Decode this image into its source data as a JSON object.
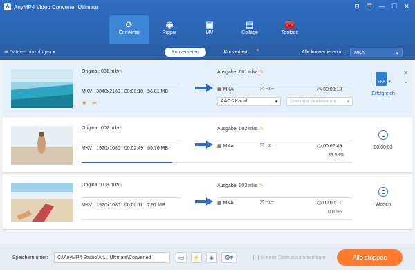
{
  "app": {
    "title": "AnyMP4 Video Converter Ultimate",
    "logo_letter": "A"
  },
  "window_buttons": [
    "⊡",
    "☰",
    "—",
    "☐",
    "✕"
  ],
  "nav": [
    {
      "label": "Converter",
      "icon": "⟳",
      "active": true
    },
    {
      "label": "Ripper",
      "icon": "◉"
    },
    {
      "label": "MV",
      "icon": "▣"
    },
    {
      "label": "Collage",
      "icon": "▤"
    },
    {
      "label": "Toolbox",
      "icon": "🧰"
    }
  ],
  "subbar": {
    "add_label": "Dateien hinzufügen",
    "seg_on": "Konvertieren",
    "seg_off": "Konvertiert",
    "convert_all_label": "Alle konvertieren in:",
    "convert_all_value": "MKA"
  },
  "rows": [
    {
      "orig": "Original: 001.mkv",
      "fmt": "MKV",
      "res": "3840x2160",
      "dur": "00:00:18",
      "size": "56.81 MB",
      "out": "Ausgabe: 001.mka",
      "ofmt": "MKA",
      "ores": "--x--",
      "odur": "00:00:18",
      "audio": "AAC-2Kanal",
      "subtitle": "Untertitel deaktivieren",
      "progress": null,
      "pct": "",
      "status": "Erfolgreich",
      "status_icon": "MKA"
    },
    {
      "orig": "Original: 002.mkv",
      "fmt": "MKV",
      "res": "1920x1080",
      "dur": "00:02:49",
      "size": "69.70 MB",
      "out": "Ausgabe: 002.mka",
      "ofmt": "MKA",
      "ores": "--x--",
      "odur": "00:02:49",
      "progress": 0.3333,
      "pct": "33.33%",
      "status": "00:00:03"
    },
    {
      "orig": "Original: 003.mkv",
      "fmt": "MKV",
      "res": "1920x1080",
      "dur": "00:00:11",
      "size": "7.91 MB",
      "out": "Ausgabe: 003.mka",
      "ofmt": "MKA",
      "ores": "--x--",
      "odur": "00:00:11",
      "progress": 0.0,
      "pct": "0.00%",
      "status": "Warten"
    }
  ],
  "bottom": {
    "save_label": "Speichern unter:",
    "path": "C:\\AnyMP4 Studio\\An... Ultimate\\Converted",
    "merge_label": "In einer Datei zusammenfügen",
    "stop_all": "Alle stoppen"
  }
}
